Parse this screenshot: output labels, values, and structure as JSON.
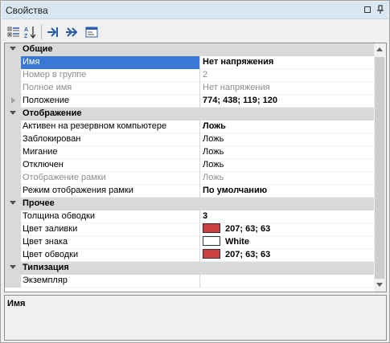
{
  "window": {
    "title": "Свойства"
  },
  "toolbar": {
    "icons": [
      "categorized-icon",
      "alphabetical-icon",
      "jump-to-icon",
      "expand-icon",
      "property-pages-icon"
    ]
  },
  "categories": [
    {
      "label": "Общие",
      "rows": [
        {
          "name": "Имя",
          "value": "Нет напряжения",
          "bold": true,
          "selected": true,
          "disabled": false
        },
        {
          "name": "Номер в группе",
          "value": "2",
          "bold": false,
          "selected": false,
          "disabled": true
        },
        {
          "name": "Полное имя",
          "value": "Нет напряжения",
          "bold": false,
          "selected": false,
          "disabled": true
        },
        {
          "name": "Положение",
          "value": "774; 438; 119; 120",
          "bold": true,
          "selected": false,
          "disabled": false,
          "expandable": true
        }
      ]
    },
    {
      "label": "Отображение",
      "rows": [
        {
          "name": "Активен на резервном компьютере",
          "value": "Ложь",
          "bold": true,
          "selected": false,
          "disabled": false
        },
        {
          "name": "Заблокирован",
          "value": "Ложь",
          "bold": false,
          "selected": false,
          "disabled": false
        },
        {
          "name": "Мигание",
          "value": "Ложь",
          "bold": false,
          "selected": false,
          "disabled": false
        },
        {
          "name": "Отключен",
          "value": "Ложь",
          "bold": false,
          "selected": false,
          "disabled": false
        },
        {
          "name": "Отображение рамки",
          "value": "Ложь",
          "bold": false,
          "selected": false,
          "disabled": true
        },
        {
          "name": "Режим отображения рамки",
          "value": "По умолчанию",
          "bold": true,
          "selected": false,
          "disabled": false
        }
      ]
    },
    {
      "label": "Прочее",
      "rows": [
        {
          "name": "Толщина обводки",
          "value": "3",
          "bold": true,
          "selected": false,
          "disabled": false
        },
        {
          "name": "Цвет заливки",
          "value": "207; 63; 63",
          "bold": true,
          "selected": false,
          "disabled": false,
          "swatch": "#cf3f3f"
        },
        {
          "name": "Цвет знака",
          "value": "White",
          "bold": true,
          "selected": false,
          "disabled": false,
          "swatch": "#ffffff"
        },
        {
          "name": "Цвет обводки",
          "value": "207; 63; 63",
          "bold": true,
          "selected": false,
          "disabled": false,
          "swatch": "#cf3f3f"
        }
      ]
    },
    {
      "label": "Типизация",
      "rows": [
        {
          "name": "Экземпляр",
          "value": "",
          "bold": false,
          "selected": false,
          "disabled": false
        }
      ]
    }
  ],
  "description": {
    "title": "Имя"
  },
  "colors": {
    "selection": "#3a78d6",
    "category_bg": "#d9d9d9",
    "title_bg": "#dbe6f3"
  }
}
